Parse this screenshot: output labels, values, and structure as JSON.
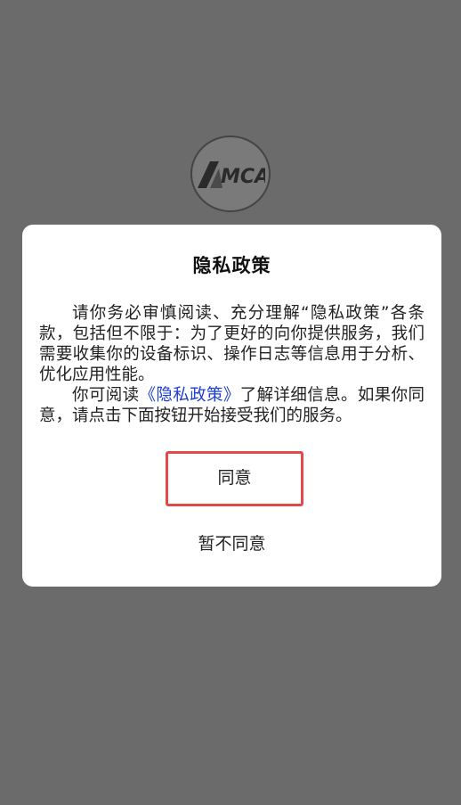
{
  "background": {
    "logo_icon": "app-logo-icon",
    "logo_text": "MCA"
  },
  "dialog": {
    "title": "隐私政策",
    "paragraph1": "请你务必审慎阅读、充分理解“隐私政策”各条款，包括但不限于：为了更好的向你提供服务，我们需要收集你的设备标识、操作日志等信息用于分析、优化应用性能。",
    "paragraph2_before": "你可阅读",
    "policy_link": "《隐私政策》",
    "paragraph2_after": "了解详细信息。如果你同意，请点击下面按钮开始接受我们的服务。",
    "agree_label": "同意",
    "disagree_label": "暂不同意"
  },
  "colors": {
    "overlay": "#6b6b6b",
    "link": "#1e3fd0",
    "highlight_border": "#e24a4a"
  }
}
